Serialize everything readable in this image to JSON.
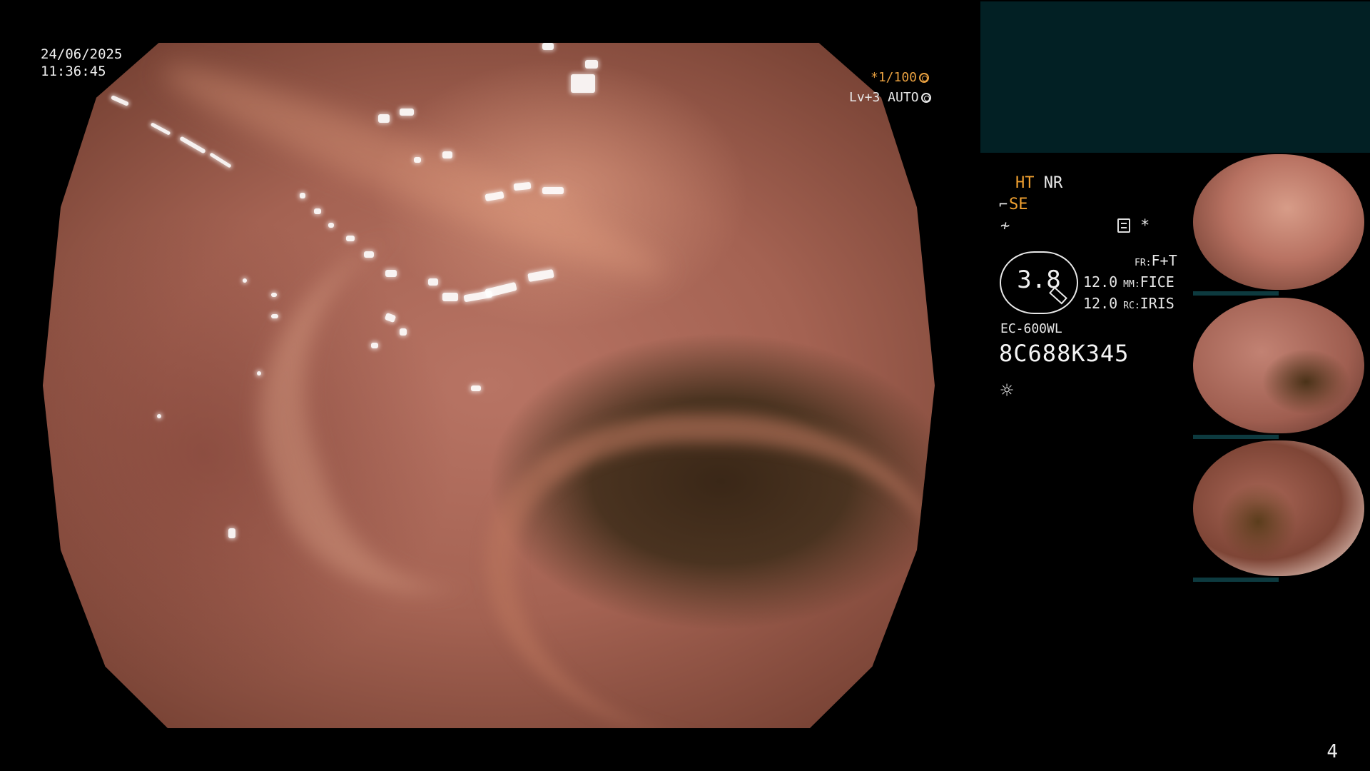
{
  "timestamp": {
    "date": "24/06/2025",
    "time": "11:36:45"
  },
  "exposure": {
    "shutter": "*1/100",
    "shutter_icon": "shutter-icon",
    "level": "Lv+3 AUTO",
    "level_icon": "auto-iris-icon"
  },
  "modes": {
    "ht": "HT",
    "nr": "NR",
    "se": "SE",
    "se_icon": "scope-tip-icon",
    "freeze_icon": "freeze-icon"
  },
  "memo": {
    "icon": "memo-icon",
    "star": "*"
  },
  "zoom": {
    "value": "3.8"
  },
  "params": [
    {
      "num": "",
      "key": "FR:",
      "val": "F+T"
    },
    {
      "num": "12.0",
      "key": "MM:",
      "val": "FICE"
    },
    {
      "num": "12.0",
      "key": "RC:",
      "val": "IRIS"
    }
  ],
  "scope": {
    "model": "EC-600WL",
    "serial": "8C688K345",
    "light_icon": "brightness-icon"
  },
  "thumbnails": [
    {
      "label": "captured-image-1"
    },
    {
      "label": "captured-image-2"
    },
    {
      "label": "captured-image-3"
    }
  ],
  "page_number": "4",
  "colors": {
    "accent": "#f0a030",
    "panel": "#022024",
    "text": "#e8e8e8"
  }
}
